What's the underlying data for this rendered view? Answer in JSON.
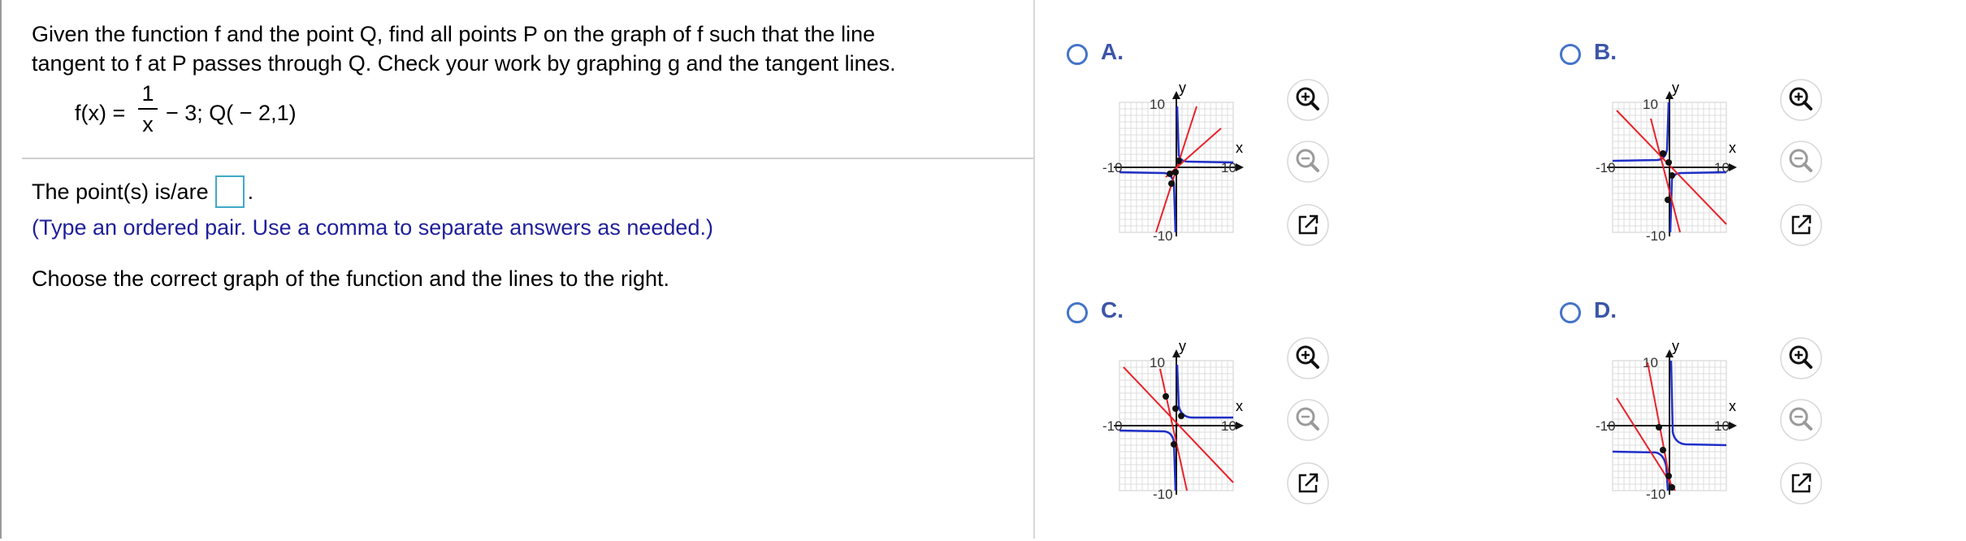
{
  "question": {
    "prompt_line1": "Given the function f and the point Q, find all points P on the graph of f such that the line",
    "prompt_line2": "tangent to f at P passes through Q. Check your work by graphing g and the tangent lines.",
    "function_lhs": "f(x) =",
    "frac_num": "1",
    "frac_den": "x",
    "function_rest": "− 3; Q( − 2,1)",
    "answer_label": "The point(s) is/are",
    "answer_value": "",
    "answer_suffix": ".",
    "hint": "(Type an ordered pair. Use a comma to separate answers as needed.)",
    "choose_text": "Choose the correct graph of the function and the lines to the right."
  },
  "options": [
    {
      "label": "A."
    },
    {
      "label": "B."
    },
    {
      "label": "C."
    },
    {
      "label": "D."
    }
  ],
  "graph_labels": {
    "x_axis": "x",
    "y_axis": "y",
    "y_max": "10",
    "y_min": "-10",
    "x_min": "-10",
    "x_max": "10"
  },
  "colors": {
    "accent": "#4474c9",
    "hint": "#1f1f9a",
    "function_curve": "#1f2fc8",
    "tangent_line": "#e8222a",
    "grid": "#d8d8d8"
  },
  "icons": [
    "zoom-in-icon",
    "zoom-out-icon",
    "open-new-window-icon"
  ]
}
